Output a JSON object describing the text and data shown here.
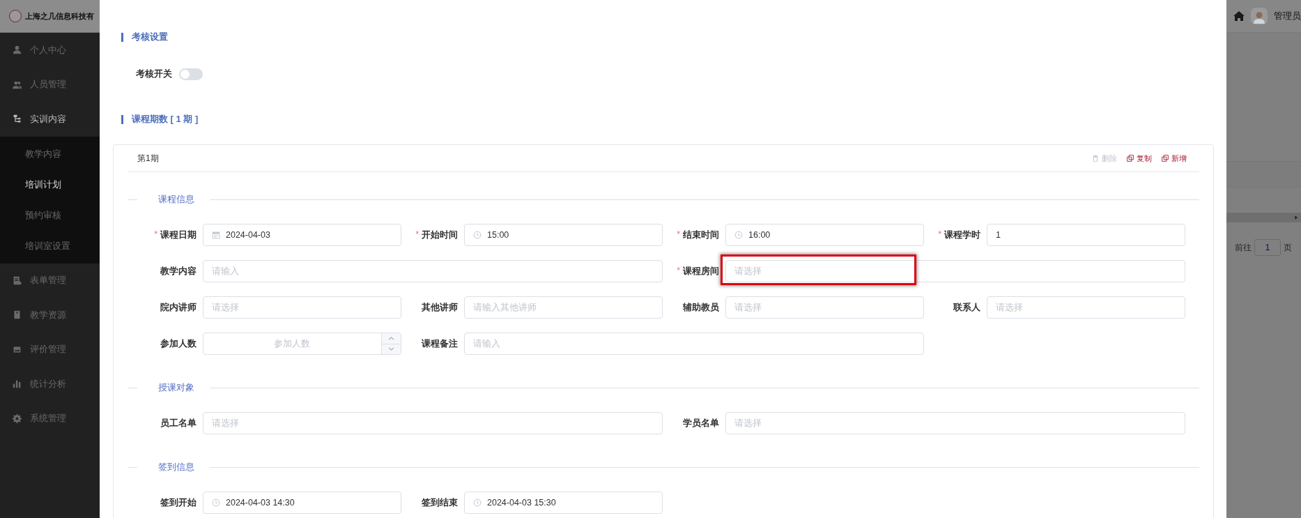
{
  "header": {
    "company": "上海之几信息科技有",
    "user": "管理员"
  },
  "sidebar": {
    "items": [
      {
        "label": "个人中心",
        "expanded": false
      },
      {
        "label": "人员管理",
        "expanded": false
      },
      {
        "label": "实训内容",
        "expanded": true,
        "children": [
          {
            "label": "教学内容",
            "selected": false
          },
          {
            "label": "培训计划",
            "selected": true
          },
          {
            "label": "预约审核",
            "selected": false
          },
          {
            "label": "培训室设置",
            "selected": false
          }
        ]
      },
      {
        "label": "表单管理",
        "expanded": false
      },
      {
        "label": "教学资源",
        "expanded": false
      },
      {
        "label": "评价管理",
        "expanded": false
      },
      {
        "label": "统计分析",
        "expanded": false
      },
      {
        "label": "系统管理",
        "expanded": false
      }
    ]
  },
  "background": {
    "pager": {
      "before": "前往",
      "page": "1",
      "after": "页"
    }
  },
  "modal": {
    "assessment": {
      "title": "考核设置",
      "switch": {
        "label": "考核开关",
        "on": false
      }
    },
    "periods": {
      "title": "课程期数 [ 1 期 ]",
      "cards": [
        {
          "title": "第1期",
          "actions": [
            {
              "kind": "delete",
              "label": "删除",
              "disabled": true
            },
            {
              "kind": "copy",
              "label": "复制",
              "disabled": false
            },
            {
              "kind": "add",
              "label": "新增",
              "disabled": false
            }
          ],
          "sections": [
            {
              "title": "课程信息",
              "rows": [
                [
                  {
                    "required_mark": "*",
                    "label": "课程日期",
                    "kind": "date",
                    "value": "2024-04-03"
                  },
                  {
                    "required_mark": "*",
                    "label": "开始时间",
                    "kind": "time",
                    "value": "15:00"
                  },
                  {
                    "required_mark": "*",
                    "label": "结束时间",
                    "kind": "time",
                    "value": "16:00"
                  },
                  {
                    "required_mark": "*",
                    "label": "课程学时",
                    "kind": "text",
                    "value": "1"
                  }
                ],
                [
                  {
                    "label": "教学内容",
                    "kind": "text",
                    "placeholder": "请输入",
                    "colspan": 2
                  },
                  {
                    "required_mark": "*",
                    "label": "课程房间",
                    "kind": "select",
                    "placeholder": "请选择",
                    "colspan": 2,
                    "highlighted": true
                  }
                ],
                [
                  {
                    "label": "院内讲师",
                    "kind": "select",
                    "placeholder": "请选择"
                  },
                  {
                    "label": "其他讲师",
                    "kind": "text",
                    "placeholder": "请输入其他讲师"
                  },
                  {
                    "label": "辅助教员",
                    "kind": "select",
                    "placeholder": "请选择"
                  },
                  {
                    "label": "联系人",
                    "kind": "select",
                    "placeholder": "请选择"
                  }
                ],
                [
                  {
                    "label": "参加人数",
                    "kind": "number",
                    "placeholder": "参加人数"
                  },
                  {
                    "label": "课程备注",
                    "kind": "text",
                    "placeholder": "请输入",
                    "colspan": 2
                  }
                ]
              ]
            },
            {
              "title": "授课对象",
              "rows": [
                [
                  {
                    "label": "员工名单",
                    "kind": "select",
                    "placeholder": "请选择",
                    "colspan": 2
                  },
                  {
                    "label": "学员名单",
                    "kind": "select",
                    "placeholder": "请选择",
                    "colspan": 2
                  }
                ]
              ]
            },
            {
              "title": "签到信息",
              "rows": [
                [
                  {
                    "label": "签到开始",
                    "kind": "time",
                    "value": "2024-04-03 14:30"
                  },
                  {
                    "label": "签到结束",
                    "kind": "time",
                    "value": "2024-04-03 15:30"
                  }
                ]
              ]
            }
          ]
        }
      ]
    }
  }
}
